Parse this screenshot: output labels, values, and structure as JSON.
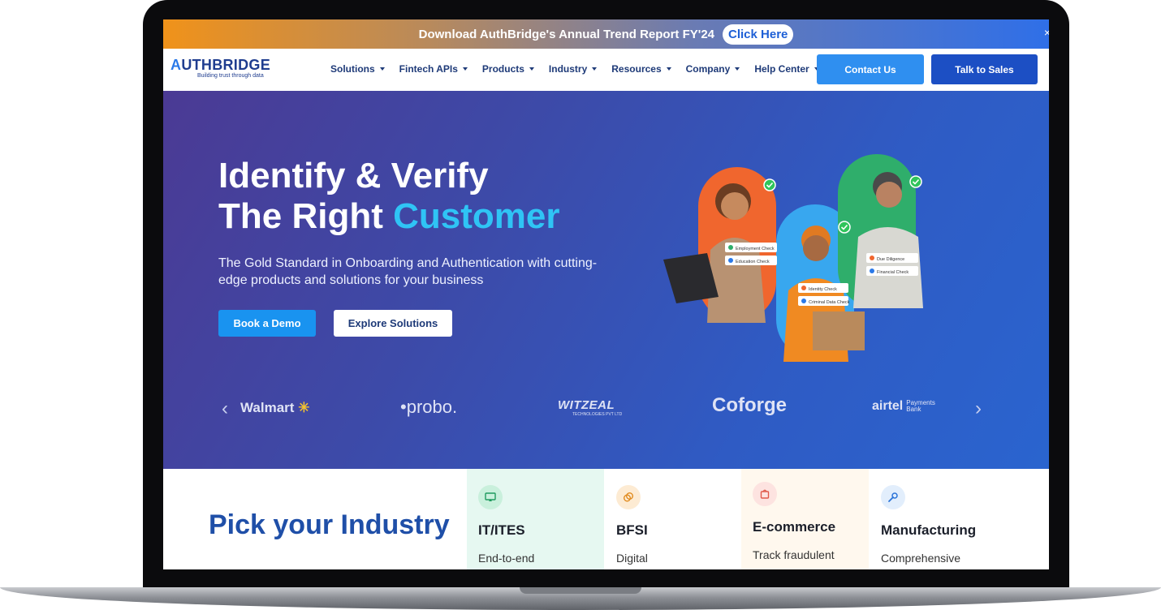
{
  "announcement": {
    "text": "Download AuthBridge's Annual Trend Report FY'24",
    "cta": "Click Here",
    "close_glyph": "×"
  },
  "brand": {
    "name_prefix": "A",
    "name_rest": "UTHBRIDGE",
    "tagline": "Building trust through data"
  },
  "nav": {
    "items": [
      "Solutions",
      "Fintech APIs",
      "Products",
      "Industry",
      "Resources",
      "Company",
      "Help Center"
    ],
    "contact": "Contact Us",
    "sales": "Talk to Sales"
  },
  "hero": {
    "title_line1": "Identify & Verify",
    "title_line2_plain": "The Right ",
    "title_line2_accent": "Customer",
    "subtitle": "The Gold Standard in Onboarding and Authentication with cutting-edge products and solutions for your business",
    "btn_demo": "Book a Demo",
    "btn_explore": "Explore Solutions",
    "check_tags": {
      "employment": "Employment Check",
      "education": "Education Check",
      "identity": "Identity Check",
      "criminal": "Criminal Data Check",
      "diligence": "Due Diligence",
      "financial": "Financial Check"
    }
  },
  "clients": {
    "walmart": "Walmart",
    "probo": "•probo.",
    "witzeal": "WITZEAL",
    "witzeal_sub": "TECHNOLOGIES PVT LTD",
    "coforge": "Coforge",
    "airtel": "airtel",
    "airtel_sub1": "Payments",
    "airtel_sub2": "Bank",
    "prev": "‹",
    "next": "›"
  },
  "industry": {
    "heading": "Pick your Industry",
    "cards": [
      {
        "title": "IT/ITES",
        "desc": "End-to-end",
        "icon": "monitor-icon",
        "bg": "#e6f8f1",
        "icon_bg": "#c9f0dc",
        "icon_color": "#1f9a5e"
      },
      {
        "title": "BFSI",
        "desc": "Digital",
        "icon": "coins-icon",
        "bg": "#ffffff",
        "icon_bg": "#fdebd3",
        "icon_color": "#e08a1e"
      },
      {
        "title": "E-commerce",
        "desc": "Track fraudulent",
        "icon": "shopping-bag-icon",
        "bg": "#fff8ee",
        "icon_bg": "#fde3e0",
        "icon_color": "#e05a4a"
      },
      {
        "title": "Manufacturing",
        "desc": "Comprehensive",
        "icon": "wrench-icon",
        "bg": "#ffffff",
        "icon_bg": "#e2eefc",
        "icon_color": "#2a73d8"
      }
    ]
  }
}
